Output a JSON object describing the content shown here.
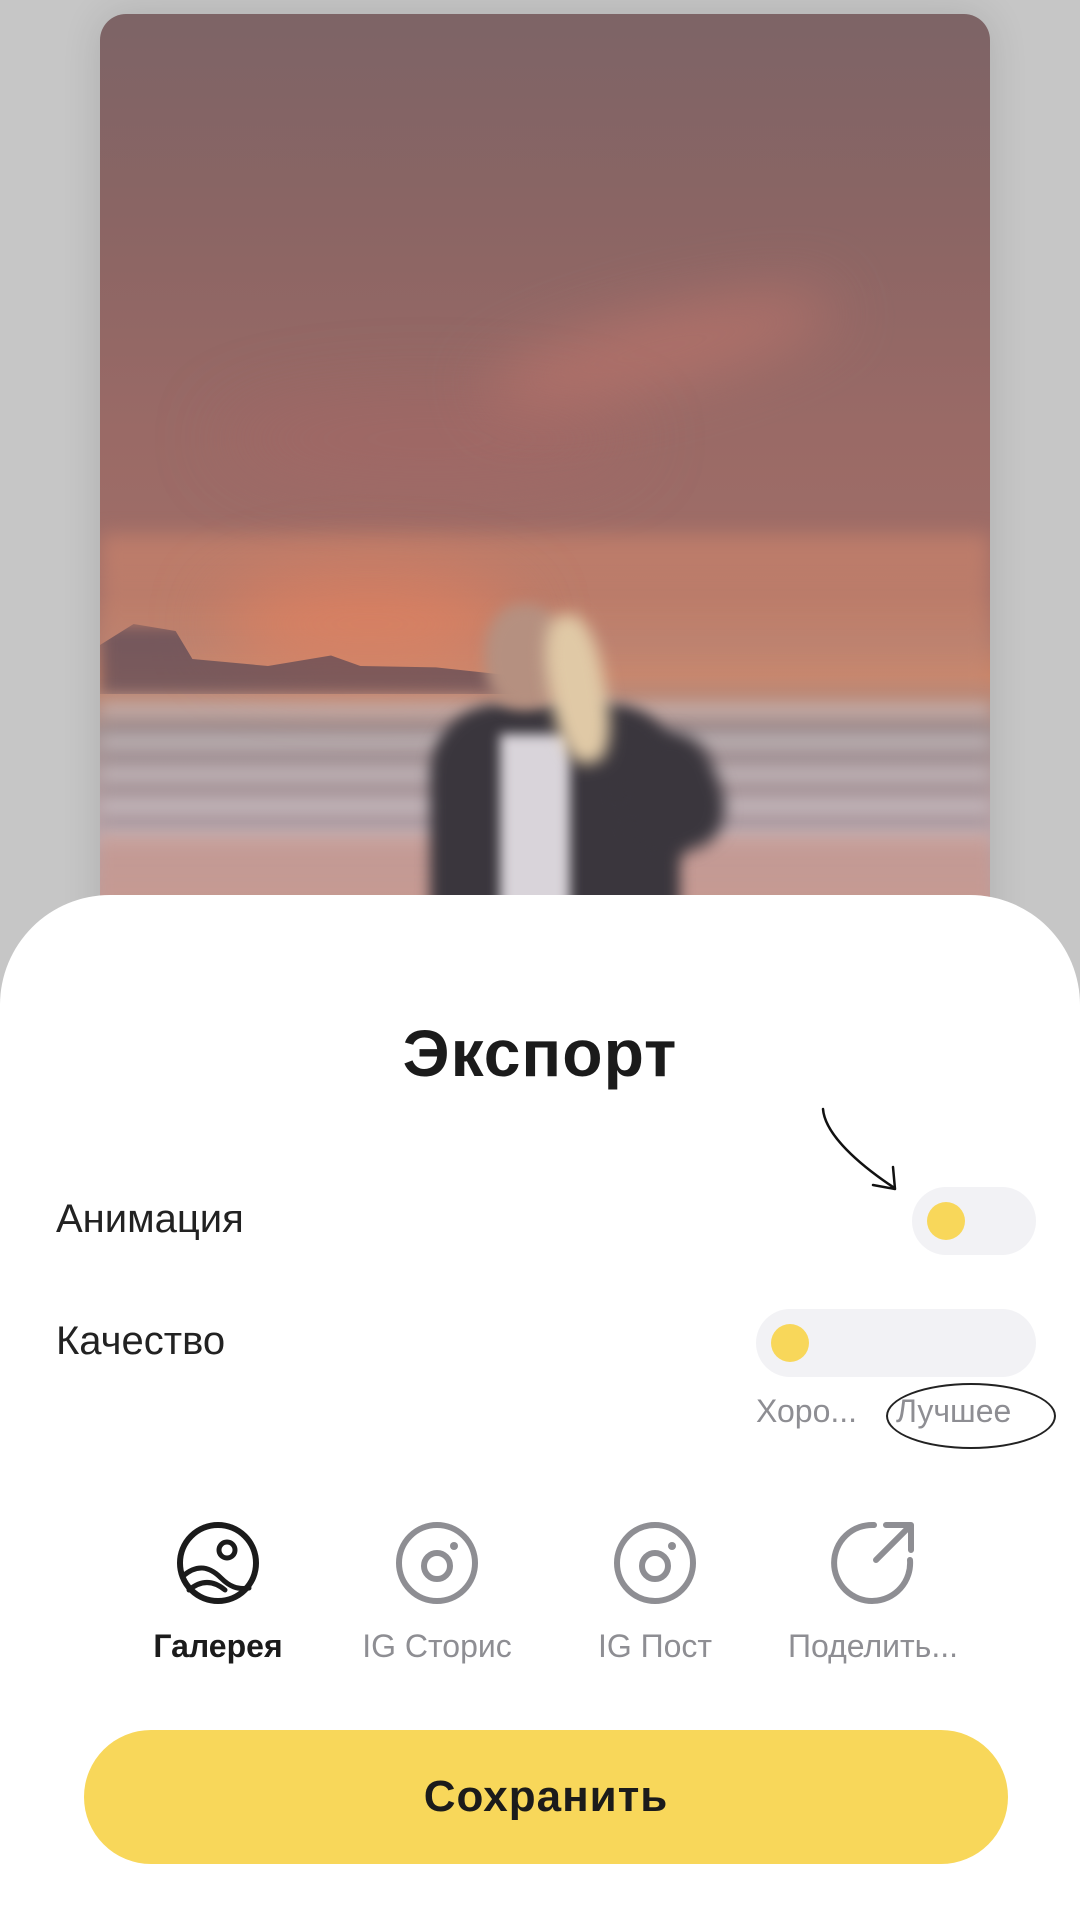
{
  "preview": {
    "description_icon": "photo-preview"
  },
  "sheet": {
    "title": "Экспорт",
    "animation": {
      "label": "Анимация",
      "enabled": false
    },
    "quality": {
      "label": "Качество",
      "options": [
        "Хоро...",
        "Лучшее"
      ],
      "selected_index": 0
    },
    "share_targets": [
      {
        "label": "Галерея",
        "icon": "gallery-icon",
        "active": true
      },
      {
        "label": "IG Сторис",
        "icon": "instagram-icon",
        "active": false
      },
      {
        "label": "IG Пост",
        "icon": "instagram-icon",
        "active": false
      },
      {
        "label": "Поделить...",
        "icon": "share-icon",
        "active": false
      }
    ],
    "save_label": "Сохранить"
  },
  "colors": {
    "accent": "#f8d75a",
    "track": "#f2f2f5",
    "muted_text": "#8e8e93",
    "text": "#1b1b1b"
  }
}
